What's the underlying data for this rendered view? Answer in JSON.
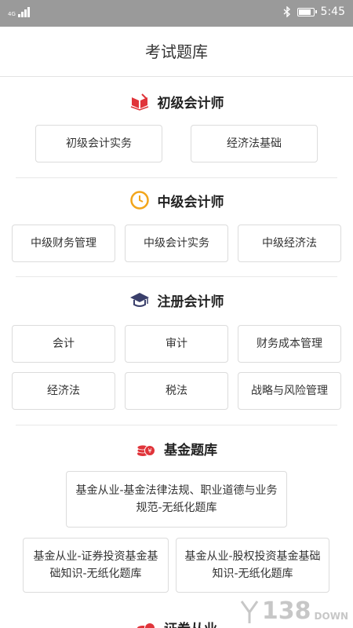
{
  "status_bar": {
    "network": "4G",
    "time": "5:45"
  },
  "header": {
    "title": "考试题库"
  },
  "sections": [
    {
      "title": "初级会计师",
      "icon": "open-book-icon",
      "buttons": [
        "初级会计实务",
        "经济法基础"
      ]
    },
    {
      "title": "中级会计师",
      "icon": "clock-icon",
      "buttons": [
        "中级财务管理",
        "中级会计实务",
        "中级经济法"
      ]
    },
    {
      "title": "注册会计师",
      "icon": "graduation-cap-icon",
      "buttons": [
        "会计",
        "审计",
        "财务成本管理",
        "经济法",
        "税法",
        "战略与风险管理"
      ]
    },
    {
      "title": "基金题库",
      "icon": "coins-icon",
      "buttons": [
        "基金从业-基金法律法规、职业道德与业务规范-无纸化题库",
        "基金从业-证券投资基金基础知识-无纸化题库",
        "基金从业-股权投资基金基础知识-无纸化题库"
      ]
    },
    {
      "title": "证券从业",
      "icon": "coins-icon"
    }
  ],
  "watermark": {
    "number": "138",
    "suffix": "DOWN"
  },
  "colors": {
    "status_bar_bg": "#9a9a9a",
    "book_icon": "#e0343a",
    "clock_icon": "#f2a51a",
    "cap_icon": "#3a3f6b",
    "coins_icon": "#e0343a"
  }
}
